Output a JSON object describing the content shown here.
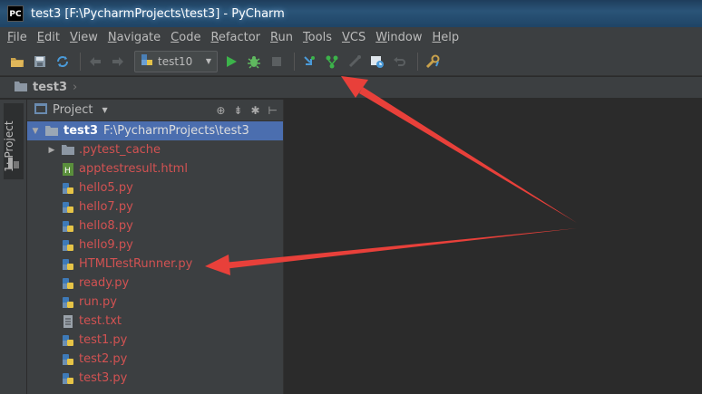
{
  "window": {
    "app_icon_text": "PC",
    "title": "test3 [F:\\PycharmProjects\\test3] - PyCharm"
  },
  "menu": [
    "File",
    "Edit",
    "View",
    "Navigate",
    "Code",
    "Refactor",
    "Run",
    "Tools",
    "VCS",
    "Window",
    "Help"
  ],
  "toolbar": {
    "run_config": "test10",
    "icons": [
      "open-folder-icon",
      "save-icon",
      "sync-icon",
      "back-icon",
      "forward-icon",
      "run-config-icon",
      "run-icon",
      "debug-icon",
      "stop-icon",
      "vcs-update-icon",
      "vcs-commit-icon",
      "vcs-compare-icon",
      "vcs-history-icon",
      "vcs-revert-icon",
      "settings-icon"
    ]
  },
  "breadcrumb": {
    "label": "test3"
  },
  "stripe": {
    "label": "1: Project"
  },
  "project_panel": {
    "title": "Project",
    "root": {
      "name": "test3",
      "path": "F:\\PycharmProjects\\test3"
    },
    "items": [
      {
        "name": ".pytest_cache",
        "type": "folder"
      },
      {
        "name": "apptestresult.html",
        "type": "html"
      },
      {
        "name": "hello5.py",
        "type": "py"
      },
      {
        "name": "hello7.py",
        "type": "py"
      },
      {
        "name": "hello8.py",
        "type": "py"
      },
      {
        "name": "hello9.py",
        "type": "py"
      },
      {
        "name": "HTMLTestRunner.py",
        "type": "py"
      },
      {
        "name": "ready.py",
        "type": "py"
      },
      {
        "name": "run.py",
        "type": "py"
      },
      {
        "name": "test.txt",
        "type": "txt"
      },
      {
        "name": "test1.py",
        "type": "py"
      },
      {
        "name": "test2.py",
        "type": "py"
      },
      {
        "name": "test3.py",
        "type": "py"
      }
    ]
  },
  "colors": {
    "accent_selected": "#4b6eaf",
    "annotation_arrow": "#e8403a",
    "file_text": "#d25252"
  }
}
